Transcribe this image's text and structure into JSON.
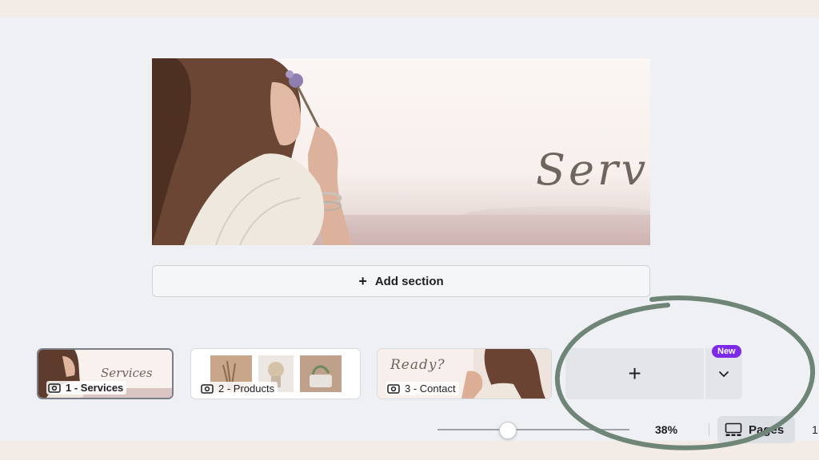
{
  "canvas": {
    "title": "Services"
  },
  "add_section": {
    "icon": "plus-icon",
    "label": "Add section"
  },
  "pages": [
    {
      "label": "1 - Services",
      "active": true,
      "icon": "eye-icon"
    },
    {
      "label": "2 - Products",
      "active": false,
      "icon": "eye-icon"
    },
    {
      "label": "3 - Contact",
      "active": false,
      "icon": "eye-icon",
      "preview_text": "Ready?"
    }
  ],
  "add_page": {
    "icon": "plus-icon",
    "dropdown_icon": "chevron-down-icon",
    "badge": "New"
  },
  "footer": {
    "zoom": "38%",
    "zoom_fraction": 0.38,
    "pages_label": "Pages",
    "pages_icon": "pages-grid-icon",
    "overflow_text": "1"
  },
  "colors": {
    "accent_badge": "#7d2ae8",
    "annotation_circle": "#6f8577"
  }
}
